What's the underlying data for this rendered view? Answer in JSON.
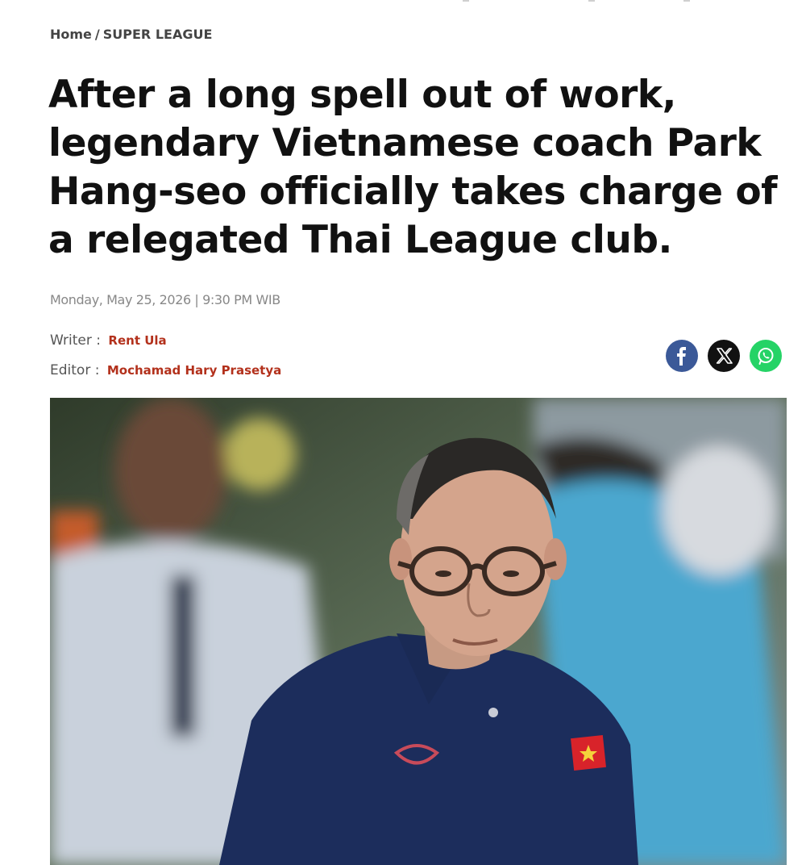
{
  "breadcrumb": {
    "home": "Home",
    "separator": "/",
    "section": "SUPER LEAGUE"
  },
  "article": {
    "headline": "After a long spell out of work, legendary Vietnamese coach Park Hang-seo officially takes charge of a relegated Thai League club.",
    "dateline": "Monday, May 25, 2026 | 9:30 PM WIB",
    "writer_label": "Writer :",
    "writer_name": "Rent Ula",
    "editor_label": "Editor :",
    "editor_name": "Mochamad Hary Prasetya"
  },
  "share": {
    "facebook_icon": "facebook-icon",
    "x_icon": "x-icon",
    "whatsapp_icon": "whatsapp-icon",
    "colors": {
      "facebook": "#3b5998",
      "x": "#111111",
      "whatsapp": "#25d366"
    }
  },
  "image": {
    "description_icon": "hero-photo"
  },
  "colors": {
    "accent": "#b3311c",
    "muted": "#888888"
  }
}
